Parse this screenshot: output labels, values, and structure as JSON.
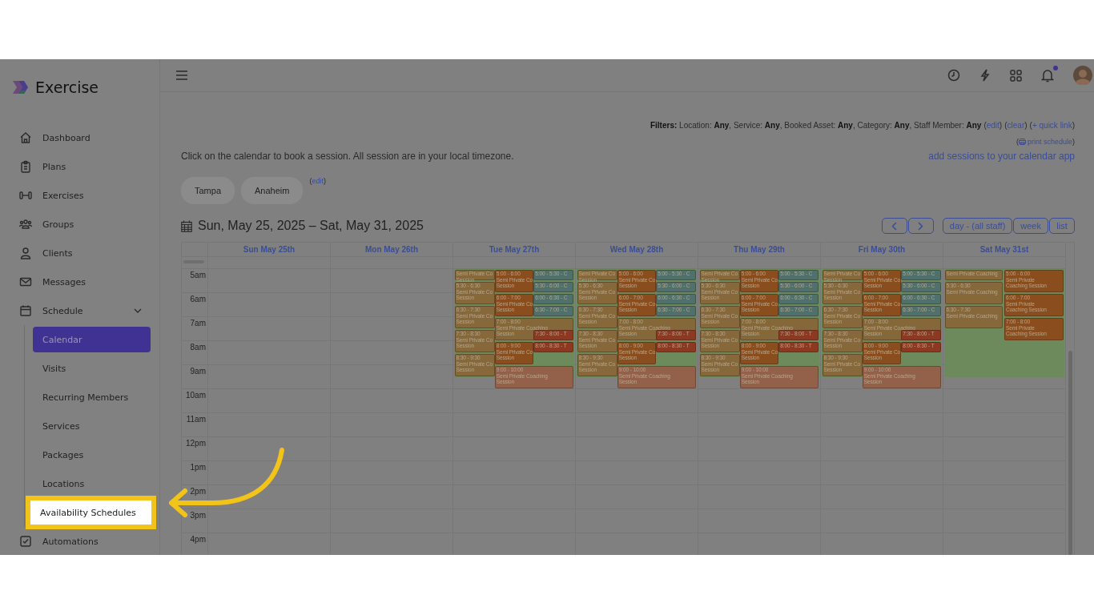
{
  "app": {
    "name": "Exercise"
  },
  "sidebar": {
    "items": [
      {
        "label": "Dashboard",
        "selected": false
      },
      {
        "label": "Plans",
        "selected": false
      },
      {
        "label": "Exercises",
        "selected": false
      },
      {
        "label": "Groups",
        "selected": false
      },
      {
        "label": "Clients",
        "selected": false
      },
      {
        "label": "Messages",
        "selected": false
      },
      {
        "label": "Schedule",
        "selected": false,
        "expanded": true,
        "children": [
          {
            "label": "Calendar",
            "selected": true,
            "highlighted": false
          },
          {
            "label": "Visits",
            "selected": false,
            "highlighted": false
          },
          {
            "label": "Recurring Members",
            "selected": false,
            "highlighted": false
          },
          {
            "label": "Services",
            "selected": false,
            "highlighted": false
          },
          {
            "label": "Packages",
            "selected": false,
            "highlighted": false
          },
          {
            "label": "Locations",
            "selected": false,
            "highlighted": false
          },
          {
            "label": "Availability Schedules",
            "selected": false,
            "highlighted": true
          }
        ]
      },
      {
        "label": "Automations",
        "selected": false
      }
    ]
  },
  "topbar": {
    "unread_notifications": true
  },
  "filters": {
    "text": "**Filters:** Location: **Any**, Service: **Any**, Booked Asset: **Any**, Category: **Any**, Staff Member: **Any**",
    "links": [
      {
        "before": "(",
        "text": "edit",
        "after": ")"
      },
      {
        "before": "(",
        "text": "clear",
        "after": ")"
      },
      {
        "before": "(",
        "text": "+ quick link",
        "after": ")"
      }
    ]
  },
  "print_link": {
    "before": "(",
    "text": "print schedule",
    "after": ")"
  },
  "intro": "Click on the calendar to book a session. All session are in your local timezone.",
  "calendar_app_link": "add sessions to your calendar app",
  "locations": [
    {
      "label": "Tampa"
    },
    {
      "label": "Anaheim"
    }
  ],
  "locations_edit": {
    "before": "(",
    "text": "edit",
    "after": ")"
  },
  "calendar": {
    "title": "Sun, May 25, 2025 – Sat, May 31, 2025",
    "views": [
      {
        "label": "day - (all staff)"
      },
      {
        "label": "week"
      },
      {
        "label": "list"
      }
    ],
    "times": [
      "5am",
      "6am",
      "7am",
      "8am",
      "9am",
      "10am",
      "11am",
      "12pm",
      "1pm",
      "2pm",
      "3pm",
      "4pm"
    ],
    "days": [
      {
        "label": "Sun May 25th",
        "availability": false
      },
      {
        "label": "Mon May 26th",
        "availability": false
      },
      {
        "label": "Tue May 27th",
        "kind": "three-lane",
        "availability": true,
        "events": [
          {
            "lines": [
              "Semi Private Co",
              "Session"
            ],
            "color": "#86683a"
          },
          {
            "lines": [
              "5:00 - 6:00",
              "Semi Private Co",
              "Session"
            ],
            "color": "#8a4d1d"
          },
          {
            "lines": [
              "5:00 - 5:30 - C"
            ],
            "color": "#50706c"
          },
          {
            "lines": [
              "5:30 - 6:30",
              "Semi Private Co",
              "Session"
            ],
            "color": "#86683a"
          },
          {
            "lines": [
              "5:30 - 6:00 - C"
            ],
            "color": "#50706c"
          },
          {
            "lines": [
              "6:00 - 7:00",
              "Semi Private Co",
              "Session"
            ],
            "color": "#8a4d1d"
          },
          {
            "lines": [
              "6:00 - 6:30 - C"
            ],
            "color": "#50706c"
          },
          {
            "lines": [
              "6:30 - 7:30",
              "Semi Private Co",
              "Session"
            ],
            "color": "#86683a"
          },
          {
            "lines": [
              "6:30 - 7:00 - C"
            ],
            "color": "#50706c"
          },
          {
            "lines": [
              "7:00 - 8:00",
              "Semi Private Coaching",
              "Session"
            ],
            "color": "#85683a"
          },
          {
            "lines": [
              "7:30 - 8:30",
              "Semi Private Co",
              "Session"
            ],
            "color": "#86683a"
          },
          {
            "lines": [
              "7:30 - 8:00 - T"
            ],
            "color": "#8d3820"
          },
          {
            "lines": [
              "8:00 - 9:00",
              "Semi Private Co",
              "Session"
            ],
            "color": "#8a4d1d"
          },
          {
            "lines": [
              "8:00 - 8:30 - T"
            ],
            "color": "#8d3820"
          },
          {
            "lines": [
              "8:30 - 9:30",
              "Semi Private Co",
              "Session"
            ],
            "color": "#86683a"
          },
          {
            "lines": [
              "9:00 - 10:00",
              "Semi Private Coaching",
              "Session"
            ],
            "color": "#93604a"
          }
        ]
      },
      {
        "label": "Wed May 28th",
        "kind": "three-lane",
        "availability": true,
        "events": [
          {
            "lines": [
              "Semi Private Co",
              "Session"
            ],
            "color": "#86683a"
          },
          {
            "lines": [
              "5:00 - 6:00",
              "Semi Private Co",
              "Session"
            ],
            "color": "#8a4d1d"
          },
          {
            "lines": [
              "5:00 - 5:30 - C"
            ],
            "color": "#50706c"
          },
          {
            "lines": [
              "5:30 - 6:30",
              "Semi Private Co",
              "Session"
            ],
            "color": "#86683a"
          },
          {
            "lines": [
              "5:30 - 6:00 - C"
            ],
            "color": "#50706c"
          },
          {
            "lines": [
              "6:00 - 7:00",
              "Semi Private Co",
              "Session"
            ],
            "color": "#8a4d1d"
          },
          {
            "lines": [
              "6:00 - 6:30 - C"
            ],
            "color": "#50706c"
          },
          {
            "lines": [
              "6:30 - 7:30",
              "Semi Private Co",
              "Session"
            ],
            "color": "#86683a"
          },
          {
            "lines": [
              "6:30 - 7:00 - C"
            ],
            "color": "#50706c"
          },
          {
            "lines": [
              "7:00 - 8:00",
              "Semi Private Coaching",
              "Session"
            ],
            "color": "#85683a"
          },
          {
            "lines": [
              "7:30 - 8:30",
              "Semi Private Co",
              "Session"
            ],
            "color": "#86683a"
          },
          {
            "lines": [
              "7:30 - 8:00 - T"
            ],
            "color": "#8d3820"
          },
          {
            "lines": [
              "8:00 - 9:00",
              "Semi Private Co",
              "Session"
            ],
            "color": "#8a4d1d"
          },
          {
            "lines": [
              "8:00 - 8:30 - T"
            ],
            "color": "#8d3820"
          },
          {
            "lines": [
              "8:30 - 9:30",
              "Semi Private Co",
              "Session"
            ],
            "color": "#86683a"
          },
          {
            "lines": [
              "9:00 - 10:00",
              "Semi Private Coaching",
              "Session"
            ],
            "color": "#93604a"
          }
        ]
      },
      {
        "label": "Thu May 29th",
        "kind": "three-lane",
        "availability": true,
        "events": [
          {
            "lines": [
              "Semi Private Co",
              "Session"
            ],
            "color": "#86683a"
          },
          {
            "lines": [
              "5:00 - 6:00",
              "Semi Private Co",
              "Session"
            ],
            "color": "#8a4d1d"
          },
          {
            "lines": [
              "5:00 - 5:30 - C"
            ],
            "color": "#50706c"
          },
          {
            "lines": [
              "5:30 - 6:30",
              "Semi Private Co",
              "Session"
            ],
            "color": "#86683a"
          },
          {
            "lines": [
              "5:30 - 6:00 - C"
            ],
            "color": "#50706c"
          },
          {
            "lines": [
              "6:00 - 7:00",
              "Semi Private Co",
              "Session"
            ],
            "color": "#8a4d1d"
          },
          {
            "lines": [
              "6:00 - 6:30 - C"
            ],
            "color": "#50706c"
          },
          {
            "lines": [
              "6:30 - 7:30",
              "Semi Private Co",
              "Session"
            ],
            "color": "#86683a"
          },
          {
            "lines": [
              "6:30 - 7:00 - C"
            ],
            "color": "#50706c"
          },
          {
            "lines": [
              "7:00 - 8:00",
              "Semi Private Coaching",
              "Session"
            ],
            "color": "#85683a"
          },
          {
            "lines": [
              "7:30 - 8:30",
              "Semi Private Co",
              "Session"
            ],
            "color": "#86683a"
          },
          {
            "lines": [
              "7:30 - 8:00 - T"
            ],
            "color": "#8d3820"
          },
          {
            "lines": [
              "8:00 - 9:00",
              "Semi Private Co",
              "Session"
            ],
            "color": "#8a4d1d"
          },
          {
            "lines": [
              "8:00 - 8:30 - T"
            ],
            "color": "#8d3820"
          },
          {
            "lines": [
              "8:30 - 9:30",
              "Semi Private Co",
              "Session"
            ],
            "color": "#86683a"
          },
          {
            "lines": [
              "9:00 - 10:00",
              "Semi Private Coaching",
              "Session"
            ],
            "color": "#93604a"
          }
        ]
      },
      {
        "label": "Fri May 30th",
        "kind": "three-lane",
        "availability": true,
        "events": [
          {
            "lines": [
              "Semi Private Co",
              "Session"
            ],
            "color": "#86683a"
          },
          {
            "lines": [
              "5:00 - 6:00",
              "Semi Private Co",
              "Session"
            ],
            "color": "#8a4d1d"
          },
          {
            "lines": [
              "5:00 - 5:30 - C"
            ],
            "color": "#50706c"
          },
          {
            "lines": [
              "5:30 - 6:30",
              "Semi Private Co",
              "Session"
            ],
            "color": "#86683a"
          },
          {
            "lines": [
              "5:30 - 6:00 - C"
            ],
            "color": "#50706c"
          },
          {
            "lines": [
              "6:00 - 7:00",
              "Semi Private Co",
              "Session"
            ],
            "color": "#8a4d1d"
          },
          {
            "lines": [
              "6:00 - 6:30 - C"
            ],
            "color": "#50706c"
          },
          {
            "lines": [
              "6:30 - 7:30",
              "Semi Private Co",
              "Session"
            ],
            "color": "#86683a"
          },
          {
            "lines": [
              "6:30 - 7:00 - C"
            ],
            "color": "#50706c"
          },
          {
            "lines": [
              "7:00 - 8:00",
              "Semi Private Coaching",
              "Session"
            ],
            "color": "#85683a"
          },
          {
            "lines": [
              "7:30 - 8:30",
              "Semi Private Co",
              "Session"
            ],
            "color": "#86683a"
          },
          {
            "lines": [
              "7:30 - 8:00 - T"
            ],
            "color": "#8d3820"
          },
          {
            "lines": [
              "8:00 - 9:00",
              "Semi Private Co",
              "Session"
            ],
            "color": "#8a4d1d"
          },
          {
            "lines": [
              "8:00 - 8:30 - T"
            ],
            "color": "#8d3820"
          },
          {
            "lines": [
              "8:30 - 9:30",
              "Semi Private Co",
              "Session"
            ],
            "color": "#86683a"
          },
          {
            "lines": [
              "9:00 - 10:00",
              "Semi Private Coaching",
              "Session"
            ],
            "color": "#93604a"
          }
        ]
      },
      {
        "label": "Sat May 31st",
        "kind": "two-lane",
        "availability": true,
        "events": [
          {
            "lines": [
              "Semi Private Coaching"
            ],
            "color": "#86683a"
          },
          {
            "lines": [
              "5:00 - 6:00",
              "Semi Private",
              "Coaching Session"
            ],
            "color": "#8a4d1d"
          },
          {
            "lines": [
              "5:30 - 6:30",
              "Semi Private Coaching"
            ],
            "color": "#86683a"
          },
          {
            "lines": [
              "6:00 - 7:00",
              "Semi Private",
              "Coaching Session"
            ],
            "color": "#8a4d1d"
          },
          {
            "lines": [
              "6:30 - 7:30",
              "Semi Private Coaching"
            ],
            "color": "#86683a"
          },
          {
            "lines": [
              "7:00 - 8:00",
              "Semi Private",
              "Coaching Session"
            ],
            "color": "#8a4d1d"
          }
        ]
      }
    ]
  }
}
